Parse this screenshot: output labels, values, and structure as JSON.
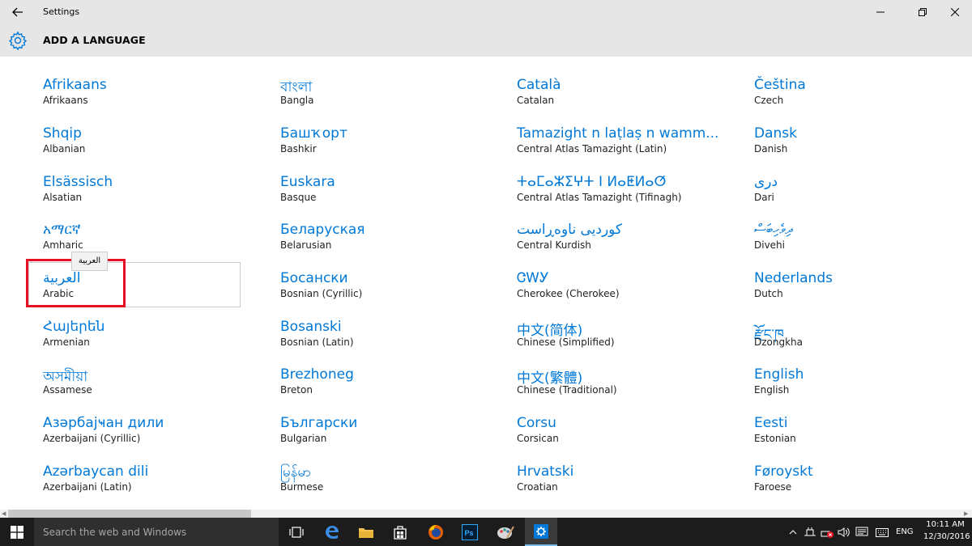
{
  "window": {
    "title": "Settings"
  },
  "header": {
    "title": "ADD A LANGUAGE"
  },
  "tooltip_text": "العربية",
  "languages": [
    {
      "native": "Afrikaans",
      "english": "Afrikaans"
    },
    {
      "native": "Shqip",
      "english": "Albanian"
    },
    {
      "native": "Elsässisch",
      "english": "Alsatian"
    },
    {
      "native": "አማርኛ",
      "english": "Amharic"
    },
    {
      "native": "العربية",
      "english": "Arabic"
    },
    {
      "native": "Հայերեն",
      "english": "Armenian"
    },
    {
      "native": "অসমীয়া",
      "english": "Assamese"
    },
    {
      "native": "Азәрбајҹан дили",
      "english": "Azerbaijani (Cyrillic)"
    },
    {
      "native": "Azərbaycan dili",
      "english": "Azerbaijani (Latin)"
    },
    {
      "native": "বাংলা",
      "english": "Bangla"
    },
    {
      "native": "Башҡорт",
      "english": "Bashkir"
    },
    {
      "native": "Euskara",
      "english": "Basque"
    },
    {
      "native": "Беларуская",
      "english": "Belarusian"
    },
    {
      "native": "Босански",
      "english": "Bosnian (Cyrillic)"
    },
    {
      "native": "Bosanski",
      "english": "Bosnian (Latin)"
    },
    {
      "native": "Brezhoneg",
      "english": "Breton"
    },
    {
      "native": "Български",
      "english": "Bulgarian"
    },
    {
      "native": "မြန်မာ",
      "english": "Burmese"
    },
    {
      "native": "Català",
      "english": "Catalan"
    },
    {
      "native": "Tamazight n laṭlaṣ n wamm...",
      "english": "Central Atlas Tamazight (Latin)"
    },
    {
      "native": "ⵜⴰⵎⴰⵣⵉⵖⵜ ⵏ ⵍⴰⵟⵍⴰⵚ",
      "english": "Central Atlas Tamazight (Tifinagh)"
    },
    {
      "native": "کوردیی ناوەڕاست",
      "english": "Central Kurdish"
    },
    {
      "native": "ᏣᎳᎩ",
      "english": "Cherokee (Cherokee)"
    },
    {
      "native": "中文(简体)",
      "english": "Chinese (Simplified)"
    },
    {
      "native": "中文(繁體)",
      "english": "Chinese (Traditional)"
    },
    {
      "native": "Corsu",
      "english": "Corsican"
    },
    {
      "native": "Hrvatski",
      "english": "Croatian"
    },
    {
      "native": "Čeština",
      "english": "Czech"
    },
    {
      "native": "Dansk",
      "english": "Danish"
    },
    {
      "native": "دری",
      "english": "Dari"
    },
    {
      "native": "ދިވެހިބަސް",
      "english": "Divehi"
    },
    {
      "native": "Nederlands",
      "english": "Dutch"
    },
    {
      "native": "རྫོང་ཁ",
      "english": "Dzongkha"
    },
    {
      "native": "English",
      "english": "English"
    },
    {
      "native": "Eesti",
      "english": "Estonian"
    },
    {
      "native": "Føroyskt",
      "english": "Faroese"
    }
  ],
  "taskbar": {
    "search_placeholder": "Search the web and Windows",
    "language": "ENG",
    "time": "10:11 AM",
    "date": "12/30/2016"
  },
  "colors": {
    "accent": "#0078d7",
    "highlight": "#e81123",
    "titlebar": "#e6e6e6",
    "taskbar": "#1c1c1c"
  }
}
